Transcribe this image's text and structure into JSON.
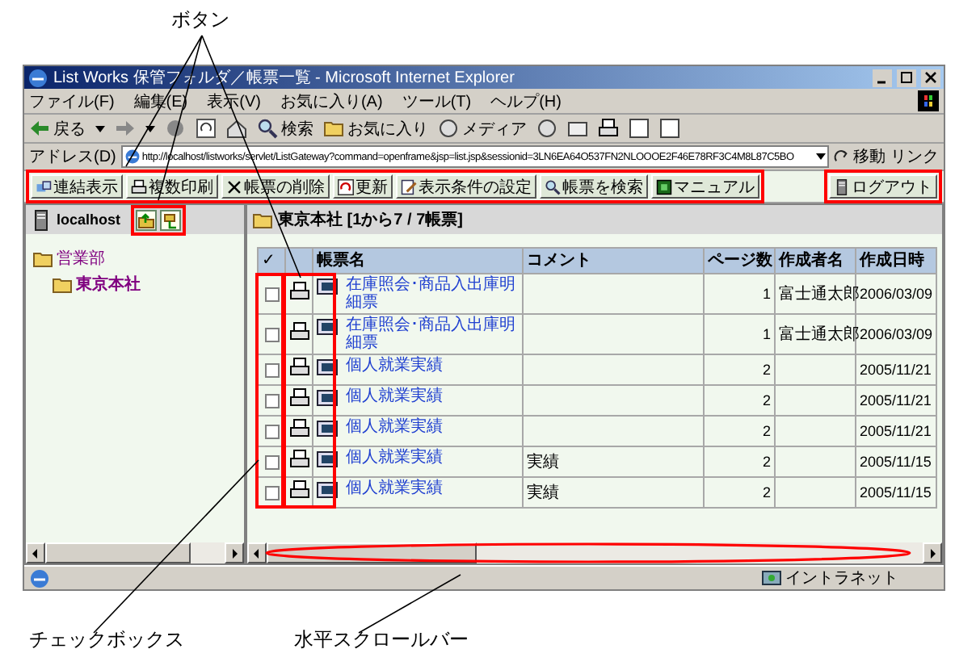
{
  "annotations": [
    {
      "text": "ボタン"
    },
    {
      "text": "チェックボックス"
    },
    {
      "text": "水平スクロールバー"
    }
  ],
  "window": {
    "title": "List Works 保管フォルダ／帳票一覧 - Microsoft Internet Explorer"
  },
  "menu": [
    "ファイル(F)",
    "編集(E)",
    "表示(V)",
    "お気に入り(A)",
    "ツール(T)",
    "ヘルプ(H)"
  ],
  "nav_toolbar": {
    "back": "戻る",
    "search": "検索",
    "favorites": "お気に入り",
    "media": "メディア"
  },
  "address_bar": {
    "label": "アドレス(D)",
    "url": "http://localhost/listworks/servlet/ListGateway?command=openframe&jsp=list.jsp&sessionid=3LN6EA64O537FN2NLOOOE2F46E78RF3C4M8L87C5BO",
    "go": "移動",
    "links": "リンク"
  },
  "app_toolbar": {
    "buttons": [
      {
        "label": "連結表示",
        "kind": "link"
      },
      {
        "label": "複数印刷",
        "kind": "print"
      },
      {
        "label": "帳票の削除",
        "kind": "delete"
      },
      {
        "label": "更新",
        "kind": "refresh"
      },
      {
        "label": "表示条件の設定",
        "kind": "settings"
      },
      {
        "label": "帳票を検索",
        "kind": "search"
      },
      {
        "label": "マニュアル",
        "kind": "manual"
      }
    ],
    "logout": "ログアウト"
  },
  "folder_pane": {
    "host": "localhost",
    "tree": [
      {
        "label": "営業部",
        "selected": false,
        "children": [
          {
            "label": "東京本社",
            "selected": true
          }
        ]
      }
    ]
  },
  "list_pane": {
    "heading": "東京本社 [1から7 / 7帳票]",
    "columns": [
      {
        "label": "✓",
        "kind": "check"
      },
      {
        "kind": "print"
      },
      {
        "label": "帳票名",
        "kind": "name"
      },
      {
        "label": "コメント",
        "kind": "comment"
      },
      {
        "label": "ページ数",
        "kind": "pages"
      },
      {
        "label": "作成者名",
        "kind": "author"
      },
      {
        "label": "作成日時",
        "kind": "date"
      }
    ],
    "rows": [
      {
        "checked": false,
        "name": "在庫照会･商品入出庫明細票",
        "pages": "1",
        "author": "富士通太郎",
        "date": "2006/03/09"
      },
      {
        "checked": false,
        "name": "在庫照会･商品入出庫明細票",
        "pages": "1",
        "author": "富士通太郎",
        "date": "2006/03/09"
      },
      {
        "checked": false,
        "name": "個人就業実績",
        "pages": "2",
        "date": "2005/11/21"
      },
      {
        "checked": false,
        "name": "個人就業実績",
        "pages": "2",
        "date": "2005/11/21"
      },
      {
        "checked": false,
        "name": "個人就業実績",
        "pages": "2",
        "date": "2005/11/21"
      },
      {
        "checked": false,
        "name": "個人就業実績",
        "comment": "実績",
        "pages": "2",
        "date": "2005/11/15"
      },
      {
        "checked": false,
        "name": "個人就業実績",
        "comment": "実績",
        "pages": "2",
        "date": "2005/11/15"
      }
    ]
  },
  "status_bar": {
    "zone": "イントラネット"
  }
}
